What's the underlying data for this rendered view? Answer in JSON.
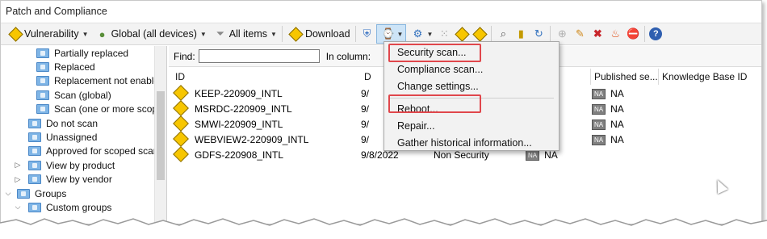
{
  "window": {
    "title": "Patch and Compliance"
  },
  "toolbar": {
    "vulnerability": "Vulnerability",
    "scope": "Global (all devices)",
    "all_items": "All items",
    "download": "Download"
  },
  "tree": {
    "items": [
      {
        "label": "Partially replaced"
      },
      {
        "label": "Replaced"
      },
      {
        "label": "Replacement not enabled"
      },
      {
        "label": "Scan (global)"
      },
      {
        "label": "Scan (one or more scope"
      },
      {
        "label": "Do not scan"
      },
      {
        "label": "Unassigned"
      },
      {
        "label": "Approved for scoped scan"
      },
      {
        "label": "View by product"
      },
      {
        "label": "View by vendor"
      },
      {
        "label": "Groups"
      },
      {
        "label": "Custom groups"
      }
    ]
  },
  "findbar": {
    "find_label": "Find:",
    "column_label": "In column:"
  },
  "grid": {
    "columns": [
      "ID",
      "D",
      "Published se...",
      "Knowledge Base ID"
    ],
    "rows": [
      {
        "id": "KEEP-220909_INTL",
        "date": "9/",
        "type": "",
        "severity": "",
        "published": "NA",
        "published_badge": "NA"
      },
      {
        "id": "MSRDC-220909_INTL",
        "date": "9/",
        "type": "",
        "severity": "",
        "published": "NA",
        "published_badge": "NA"
      },
      {
        "id": "SMWI-220909_INTL",
        "date": "9/",
        "type": "",
        "severity": "",
        "published": "NA",
        "published_badge": "NA"
      },
      {
        "id": "WEBVIEW2-220909_INTL",
        "date": "9/",
        "type": "",
        "severity": "",
        "published": "NA",
        "published_badge": "NA"
      },
      {
        "id": "GDFS-220908_INTL",
        "date": "9/8/2022",
        "type": "Non Security",
        "severity": "NA",
        "severity_badge": "NA",
        "published": "",
        "published_badge": ""
      }
    ]
  },
  "menu": {
    "items": [
      {
        "label": "Security scan..."
      },
      {
        "label": "Compliance scan..."
      },
      {
        "label": "Change settings..."
      },
      {
        "label": "Reboot..."
      },
      {
        "label": "Repair..."
      },
      {
        "label": "Gather historical information..."
      }
    ]
  },
  "colors": {
    "callout": "#e0474c",
    "selection": "#cde4f7"
  }
}
